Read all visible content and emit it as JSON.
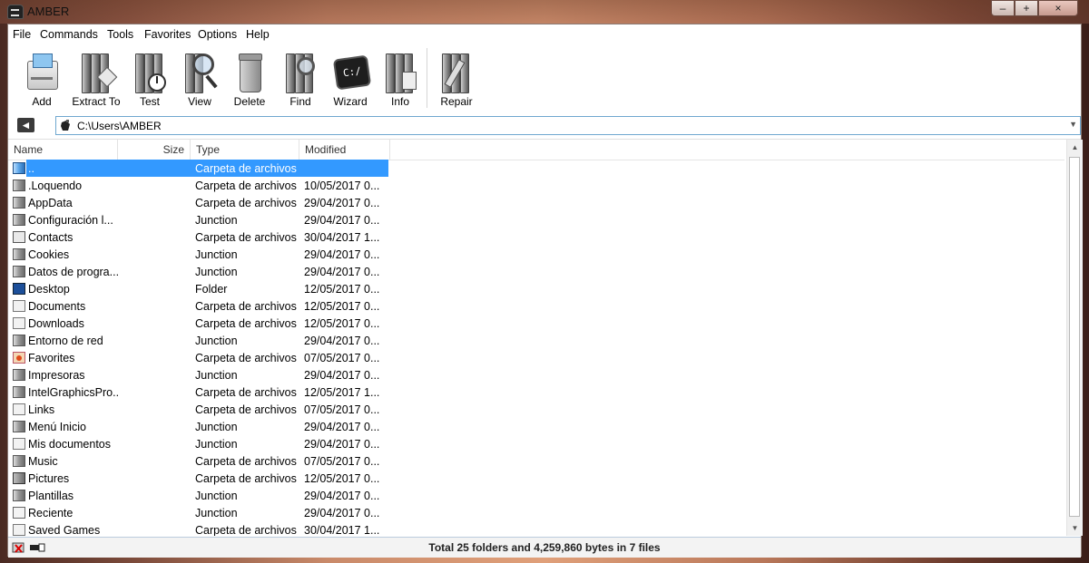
{
  "window": {
    "title": "AMBER",
    "controls": [
      "–",
      "+",
      "×"
    ]
  },
  "menu": [
    "File",
    "Commands",
    "Tools",
    "Favorites",
    "Options",
    "Help"
  ],
  "toolbar": [
    {
      "label": "Add",
      "icon": "add-archive-icon"
    },
    {
      "label": "Extract To",
      "icon": "extract-icon"
    },
    {
      "label": "Test",
      "icon": "test-icon"
    },
    {
      "label": "View",
      "icon": "view-icon"
    },
    {
      "label": "Delete",
      "icon": "delete-icon"
    },
    {
      "label": "Find",
      "icon": "find-icon"
    },
    {
      "label": "Wizard",
      "icon": "wizard-icon"
    },
    {
      "label": "Info",
      "icon": "info-icon"
    },
    {
      "label": "Repair",
      "icon": "repair-icon"
    }
  ],
  "address": {
    "path": "C:\\Users\\AMBER"
  },
  "columns": {
    "name": "Name",
    "size": "Size",
    "type": "Type",
    "modified": "Modified"
  },
  "rows": [
    {
      "name": "..",
      "type": "Carpeta de archivos",
      "modified": "",
      "icon": "up-folder-icon",
      "selected": true
    },
    {
      "name": ".Loquendo",
      "type": "Carpeta de archivos",
      "modified": "10/05/2017 0...",
      "icon": "folder-icon"
    },
    {
      "name": "AppData",
      "type": "Carpeta de archivos",
      "modified": "29/04/2017 0...",
      "icon": "folder-icon"
    },
    {
      "name": "Configuración l...",
      "type": "Junction",
      "modified": "29/04/2017 0...",
      "icon": "folder-icon"
    },
    {
      "name": "Contacts",
      "type": "Carpeta de archivos",
      "modified": "30/04/2017 1...",
      "icon": "contacts-icon"
    },
    {
      "name": "Cookies",
      "type": "Junction",
      "modified": "29/04/2017 0...",
      "icon": "folder-icon"
    },
    {
      "name": "Datos de progra...",
      "type": "Junction",
      "modified": "29/04/2017 0...",
      "icon": "folder-icon"
    },
    {
      "name": "Desktop",
      "type": "Folder",
      "modified": "12/05/2017 0...",
      "icon": "desktop-icon"
    },
    {
      "name": "Documents",
      "type": "Carpeta de archivos",
      "modified": "12/05/2017 0...",
      "icon": "documents-icon"
    },
    {
      "name": "Downloads",
      "type": "Carpeta de archivos",
      "modified": "12/05/2017 0...",
      "icon": "downloads-icon"
    },
    {
      "name": "Entorno de red",
      "type": "Junction",
      "modified": "29/04/2017 0...",
      "icon": "folder-icon"
    },
    {
      "name": "Favorites",
      "type": "Carpeta de archivos",
      "modified": "07/05/2017 0...",
      "icon": "favorites-icon"
    },
    {
      "name": "Impresoras",
      "type": "Junction",
      "modified": "29/04/2017 0...",
      "icon": "folder-icon"
    },
    {
      "name": "IntelGraphicsPro...",
      "type": "Carpeta de archivos",
      "modified": "12/05/2017 1...",
      "icon": "folder-icon"
    },
    {
      "name": "Links",
      "type": "Carpeta de archivos",
      "modified": "07/05/2017 0...",
      "icon": "links-icon"
    },
    {
      "name": "Menú Inicio",
      "type": "Junction",
      "modified": "29/04/2017 0...",
      "icon": "folder-icon"
    },
    {
      "name": "Mis documentos",
      "type": "Junction",
      "modified": "29/04/2017 0...",
      "icon": "documents-icon"
    },
    {
      "name": "Music",
      "type": "Carpeta de archivos",
      "modified": "07/05/2017 0...",
      "icon": "music-icon"
    },
    {
      "name": "Pictures",
      "type": "Carpeta de archivos",
      "modified": "12/05/2017 0...",
      "icon": "pictures-icon"
    },
    {
      "name": "Plantillas",
      "type": "Junction",
      "modified": "29/04/2017 0...",
      "icon": "folder-icon"
    },
    {
      "name": "Reciente",
      "type": "Junction",
      "modified": "29/04/2017 0...",
      "icon": "recent-icon"
    },
    {
      "name": "Saved Games",
      "type": "Carpeta de archivos",
      "modified": "30/04/2017 1...",
      "icon": "saved-games-icon"
    }
  ],
  "status": {
    "text": "Total 25 folders and 4,259,860 bytes in 7 files"
  },
  "colors": {
    "selection": "#3399ff",
    "address_border": "#6fa7cf"
  }
}
